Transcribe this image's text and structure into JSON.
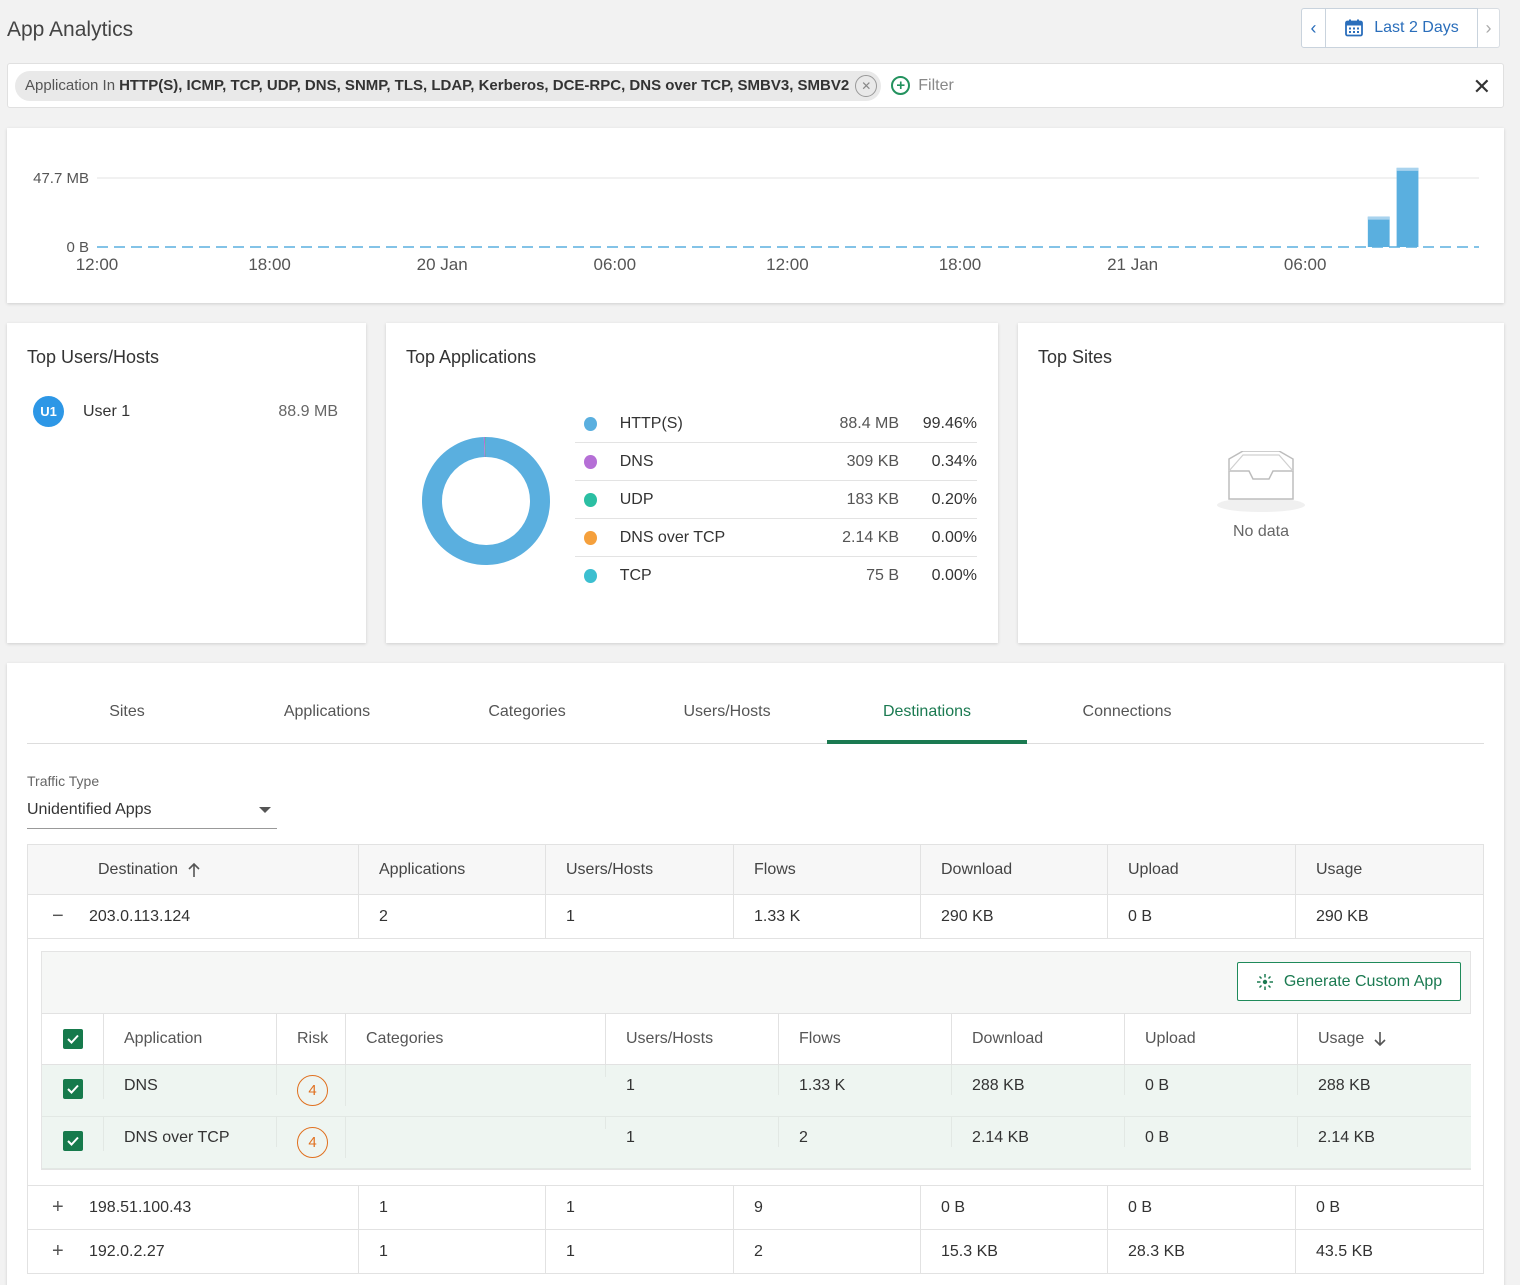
{
  "page": {
    "title": "App Analytics"
  },
  "date_picker": {
    "label": "Last 2 Days"
  },
  "filter": {
    "chip_prefix": "Application In",
    "chip_values": "HTTP(S), ICMP, TCP, UDP, DNS, SNMP, TLS, LDAP, Kerberos, DCE-RPC, DNS over TCP, SMBV3, SMBV2",
    "add_label": "Filter"
  },
  "chart_data": {
    "type": "bar",
    "y_ticks": [
      "47.7 MB",
      "0 B"
    ],
    "x_ticks": [
      "12:00",
      "18:00",
      "20 Jan",
      "06:00",
      "12:00",
      "18:00",
      "21 Jan",
      "06:00"
    ],
    "unit": "MB",
    "bars": [
      {
        "slot": 44,
        "value": 23
      },
      {
        "slot": 45,
        "value": 60
      }
    ],
    "slots": 48,
    "ylim": [
      0,
      69
    ],
    "baseline_style": "dashed",
    "color": "#5aafdf"
  },
  "top_users": {
    "title": "Top Users/Hosts",
    "items": [
      {
        "initials": "U1",
        "name": "User 1",
        "value": "88.9 MB"
      }
    ]
  },
  "top_apps": {
    "title": "Top Applications",
    "items": [
      {
        "name": "HTTP(S)",
        "size": "88.4 MB",
        "pct": "99.46%",
        "color": "#5aafdf",
        "share": 99.46
      },
      {
        "name": "DNS",
        "size": "309 KB",
        "pct": "0.34%",
        "color": "#b56fd6",
        "share": 0.34
      },
      {
        "name": "UDP",
        "size": "183 KB",
        "pct": "0.20%",
        "color": "#2bbfa3",
        "share": 0.2
      },
      {
        "name": "DNS over TCP",
        "size": "2.14 KB",
        "pct": "0.00%",
        "color": "#f5a03c",
        "share": 0.0
      },
      {
        "name": "TCP",
        "size": "75 B",
        "pct": "0.00%",
        "color": "#3cbfd0",
        "share": 0.0
      }
    ]
  },
  "top_sites": {
    "title": "Top Sites",
    "empty_text": "No data"
  },
  "tabs": [
    {
      "label": "Sites"
    },
    {
      "label": "Applications"
    },
    {
      "label": "Categories"
    },
    {
      "label": "Users/Hosts"
    },
    {
      "label": "Destinations",
      "active": true
    },
    {
      "label": "Connections"
    }
  ],
  "traffic_type": {
    "label": "Traffic Type",
    "value": "Unidentified Apps"
  },
  "dest_table": {
    "headers": [
      "Destination",
      "Applications",
      "Users/Hosts",
      "Flows",
      "Download",
      "Upload",
      "Usage"
    ],
    "rows": [
      {
        "expander": "−",
        "destination": "203.0.113.124",
        "applications": "2",
        "users": "1",
        "flows": "1.33 K",
        "download": "290 KB",
        "upload": "0 B",
        "usage": "290 KB"
      },
      {
        "expander": "+",
        "destination": "198.51.100.43",
        "applications": "1",
        "users": "1",
        "flows": "9",
        "download": "0 B",
        "upload": "0 B",
        "usage": "0 B"
      },
      {
        "expander": "+",
        "destination": "192.0.2.27",
        "applications": "1",
        "users": "1",
        "flows": "2",
        "download": "15.3 KB",
        "upload": "28.3 KB",
        "usage": "43.5 KB"
      }
    ]
  },
  "sub_table": {
    "generate_button": "Generate Custom App",
    "headers": [
      "Application",
      "Risk",
      "Categories",
      "Users/Hosts",
      "Flows",
      "Download",
      "Upload",
      "Usage"
    ],
    "rows": [
      {
        "application": "DNS",
        "risk": "4",
        "categories": "",
        "users": "1",
        "flows": "1.33 K",
        "download": "288 KB",
        "upload": "0 B",
        "usage": "288 KB"
      },
      {
        "application": "DNS over TCP",
        "risk": "4",
        "categories": "",
        "users": "1",
        "flows": "2",
        "download": "2.14 KB",
        "upload": "0 B",
        "usage": "2.14 KB"
      }
    ]
  }
}
